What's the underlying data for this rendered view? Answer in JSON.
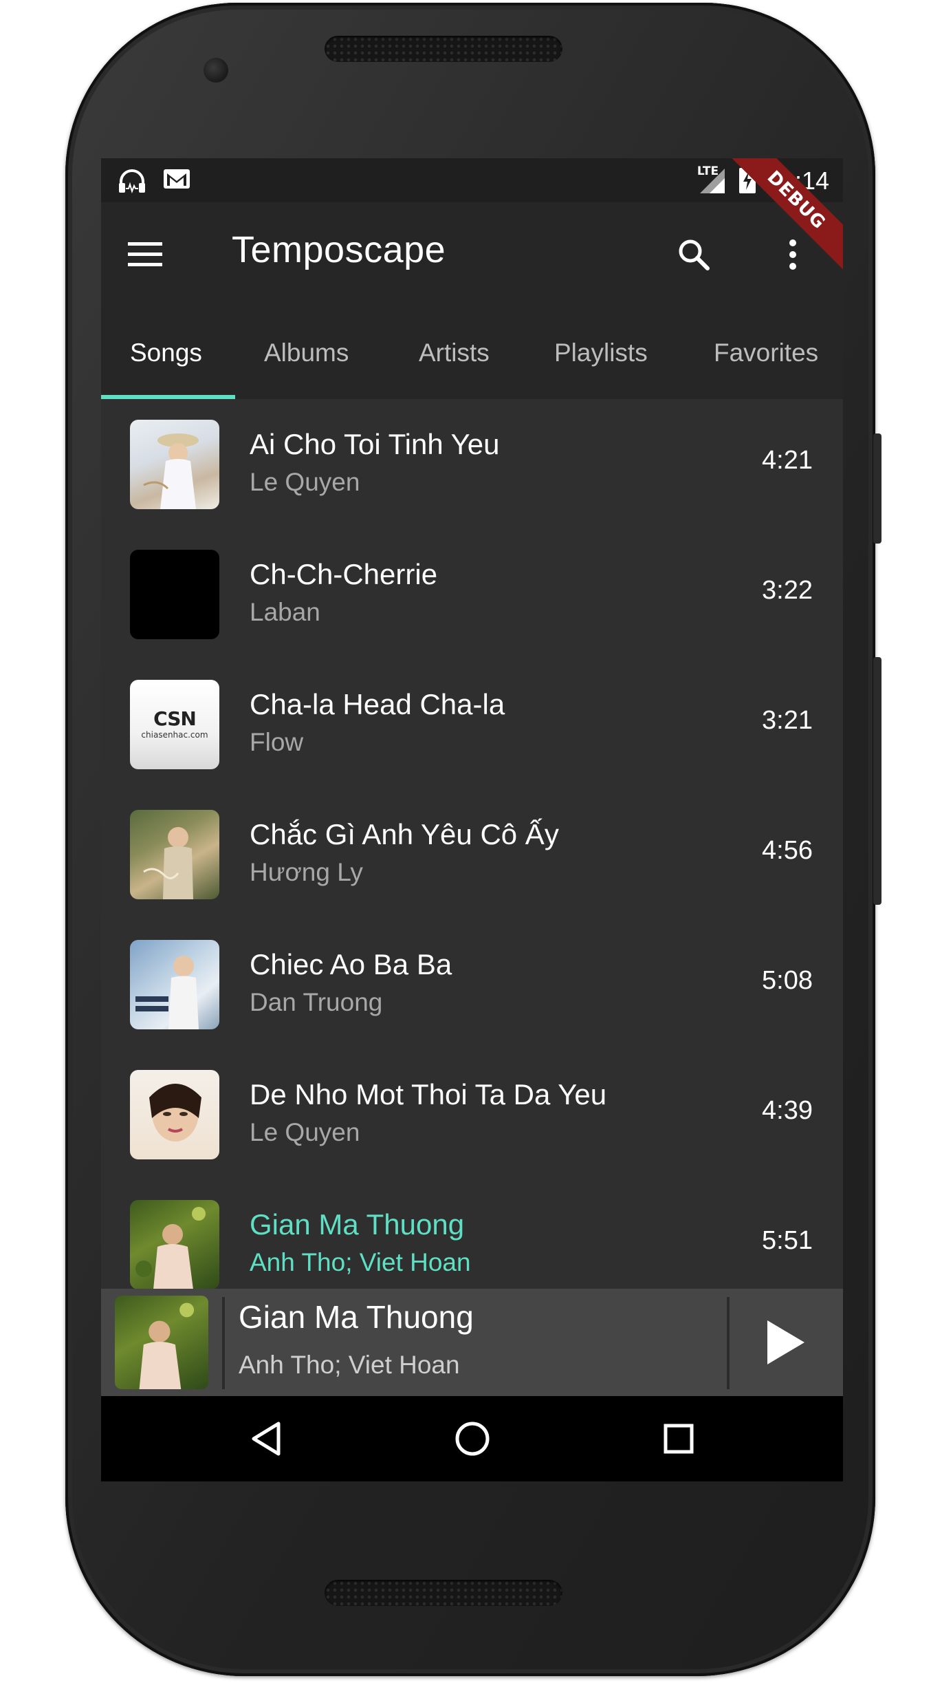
{
  "status_bar": {
    "time": "21:14",
    "left_icons": [
      "headset-icon",
      "gmail-icon"
    ],
    "right_icons": [
      "lte-signal-icon",
      "battery-charging-icon"
    ],
    "network_label": "LTE"
  },
  "debug_banner": "DEBUG",
  "app_bar": {
    "title": "Temposcape",
    "menu_icon": "hamburger-menu-icon",
    "search_icon": "search-icon",
    "overflow_icon": "more-vert-icon"
  },
  "tabs": [
    {
      "label": "Songs",
      "active": true
    },
    {
      "label": "Albums",
      "active": false
    },
    {
      "label": "Artists",
      "active": false
    },
    {
      "label": "Playlists",
      "active": false
    },
    {
      "label": "Favorites",
      "active": false
    }
  ],
  "accent_color": "#5fe0c4",
  "songs": [
    {
      "title": "Ai Cho Toi Tinh Yeu",
      "artist": "Le Quyen",
      "duration": "4:21"
    },
    {
      "title": "Ch-Ch-Cherrie",
      "artist": "Laban",
      "duration": "3:22"
    },
    {
      "title": "Cha-la Head Cha-la",
      "artist": "Flow",
      "duration": "3:21",
      "thumb_logo": "CSN",
      "thumb_caption": "chiasenhac.com"
    },
    {
      "title": "Chắc Gì Anh Yêu Cô Ấy",
      "artist": "Hương Ly",
      "duration": "4:56"
    },
    {
      "title": "Chiec Ao Ba Ba",
      "artist": "Dan Truong",
      "duration": "5:08"
    },
    {
      "title": "De Nho Mot Thoi Ta Da Yeu",
      "artist": "Le Quyen",
      "duration": "4:39"
    },
    {
      "title": "Gian Ma Thuong",
      "artist": "Anh Tho;  Viet Hoan",
      "duration": "5:51",
      "playing": true
    }
  ],
  "now_playing": {
    "title": "Gian Ma Thuong",
    "artist": "Anh Tho;  Viet Hoan",
    "control_icon": "play-icon"
  },
  "nav_bar": {
    "back_icon": "back-triangle-icon",
    "home_icon": "home-circle-icon",
    "recents_icon": "recents-square-icon"
  }
}
